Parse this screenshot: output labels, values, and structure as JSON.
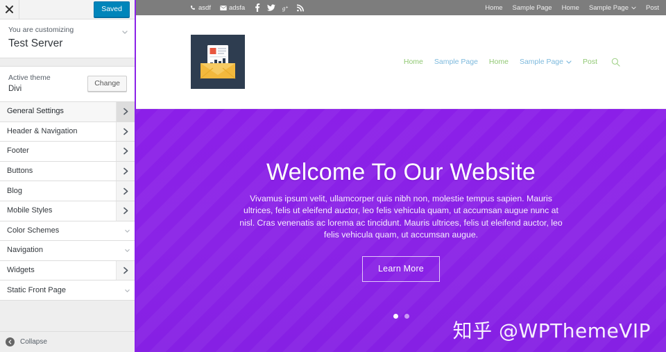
{
  "customizer": {
    "close_icon": "close-icon",
    "save_label": "Saved",
    "customizing_label": "You are customizing",
    "site_title": "Test Server",
    "theme": {
      "label": "Active theme",
      "name": "Divi",
      "change_label": "Change"
    },
    "panels": [
      {
        "label": "General Settings",
        "arrow": "chevron-right",
        "active": true
      },
      {
        "label": "Header & Navigation",
        "arrow": "chevron-right",
        "active": false
      },
      {
        "label": "Footer",
        "arrow": "chevron-right",
        "active": false
      },
      {
        "label": "Buttons",
        "arrow": "chevron-right",
        "active": false
      },
      {
        "label": "Blog",
        "arrow": "chevron-right",
        "active": false
      },
      {
        "label": "Mobile Styles",
        "arrow": "chevron-right",
        "active": false
      },
      {
        "label": "Color Schemes",
        "arrow": "chevron-down",
        "active": false
      },
      {
        "label": "Navigation",
        "arrow": "chevron-down",
        "active": false
      },
      {
        "label": "Widgets",
        "arrow": "chevron-right",
        "active": false
      },
      {
        "label": "Static Front Page",
        "arrow": "chevron-down",
        "active": false
      }
    ],
    "collapse_label": "Collapse"
  },
  "preview": {
    "top_bar": {
      "phone_icon": "phone-icon",
      "phone": "asdf",
      "email_icon": "envelope-icon",
      "email": "adsfa",
      "social": [
        "facebook-icon",
        "twitter-icon",
        "googleplus-icon",
        "rss-icon"
      ],
      "nav": [
        {
          "label": "Home",
          "caret": false
        },
        {
          "label": "Sample Page",
          "caret": false
        },
        {
          "label": "Home",
          "caret": false
        },
        {
          "label": "Sample Page",
          "caret": true
        },
        {
          "label": "Post",
          "caret": false
        }
      ]
    },
    "header": {
      "logo_icon": "site-logo-newsletter-icon",
      "nav": [
        {
          "label": "Home",
          "color": "green",
          "caret": false
        },
        {
          "label": "Sample Page",
          "color": "blue",
          "caret": false
        },
        {
          "label": "Home",
          "color": "green",
          "caret": false
        },
        {
          "label": "Sample Page",
          "color": "blue",
          "caret": true
        },
        {
          "label": "Post",
          "color": "green",
          "caret": false
        }
      ],
      "search_icon": "search-icon"
    },
    "hero": {
      "title": "Welcome To Our Website",
      "body": "Vivamus ipsum velit, ullamcorper quis nibh non, molestie tempus sapien. Mauris ultrices, felis ut eleifend auctor, leo felis vehicula quam, ut accumsan augue nunc at nisl. Cras venenatis ac lorema ac tincidunt. Mauris ultrices, felis ut eleifend auctor, leo felis vehicula quam, ut accumsan augue.",
      "cta_label": "Learn More",
      "slides": 2,
      "active_slide": 1,
      "bg_color": "#8b1fe8"
    },
    "watermark": "知乎 @WPThemeVIP"
  },
  "colors": {
    "accent_purple": "#8a21e8",
    "save_blue": "#0085ba",
    "nav_green": "#90c873",
    "nav_blue": "#7cb9dd",
    "top_bar_gray": "#7d7d7d",
    "logo_navy": "#2e3d50"
  }
}
